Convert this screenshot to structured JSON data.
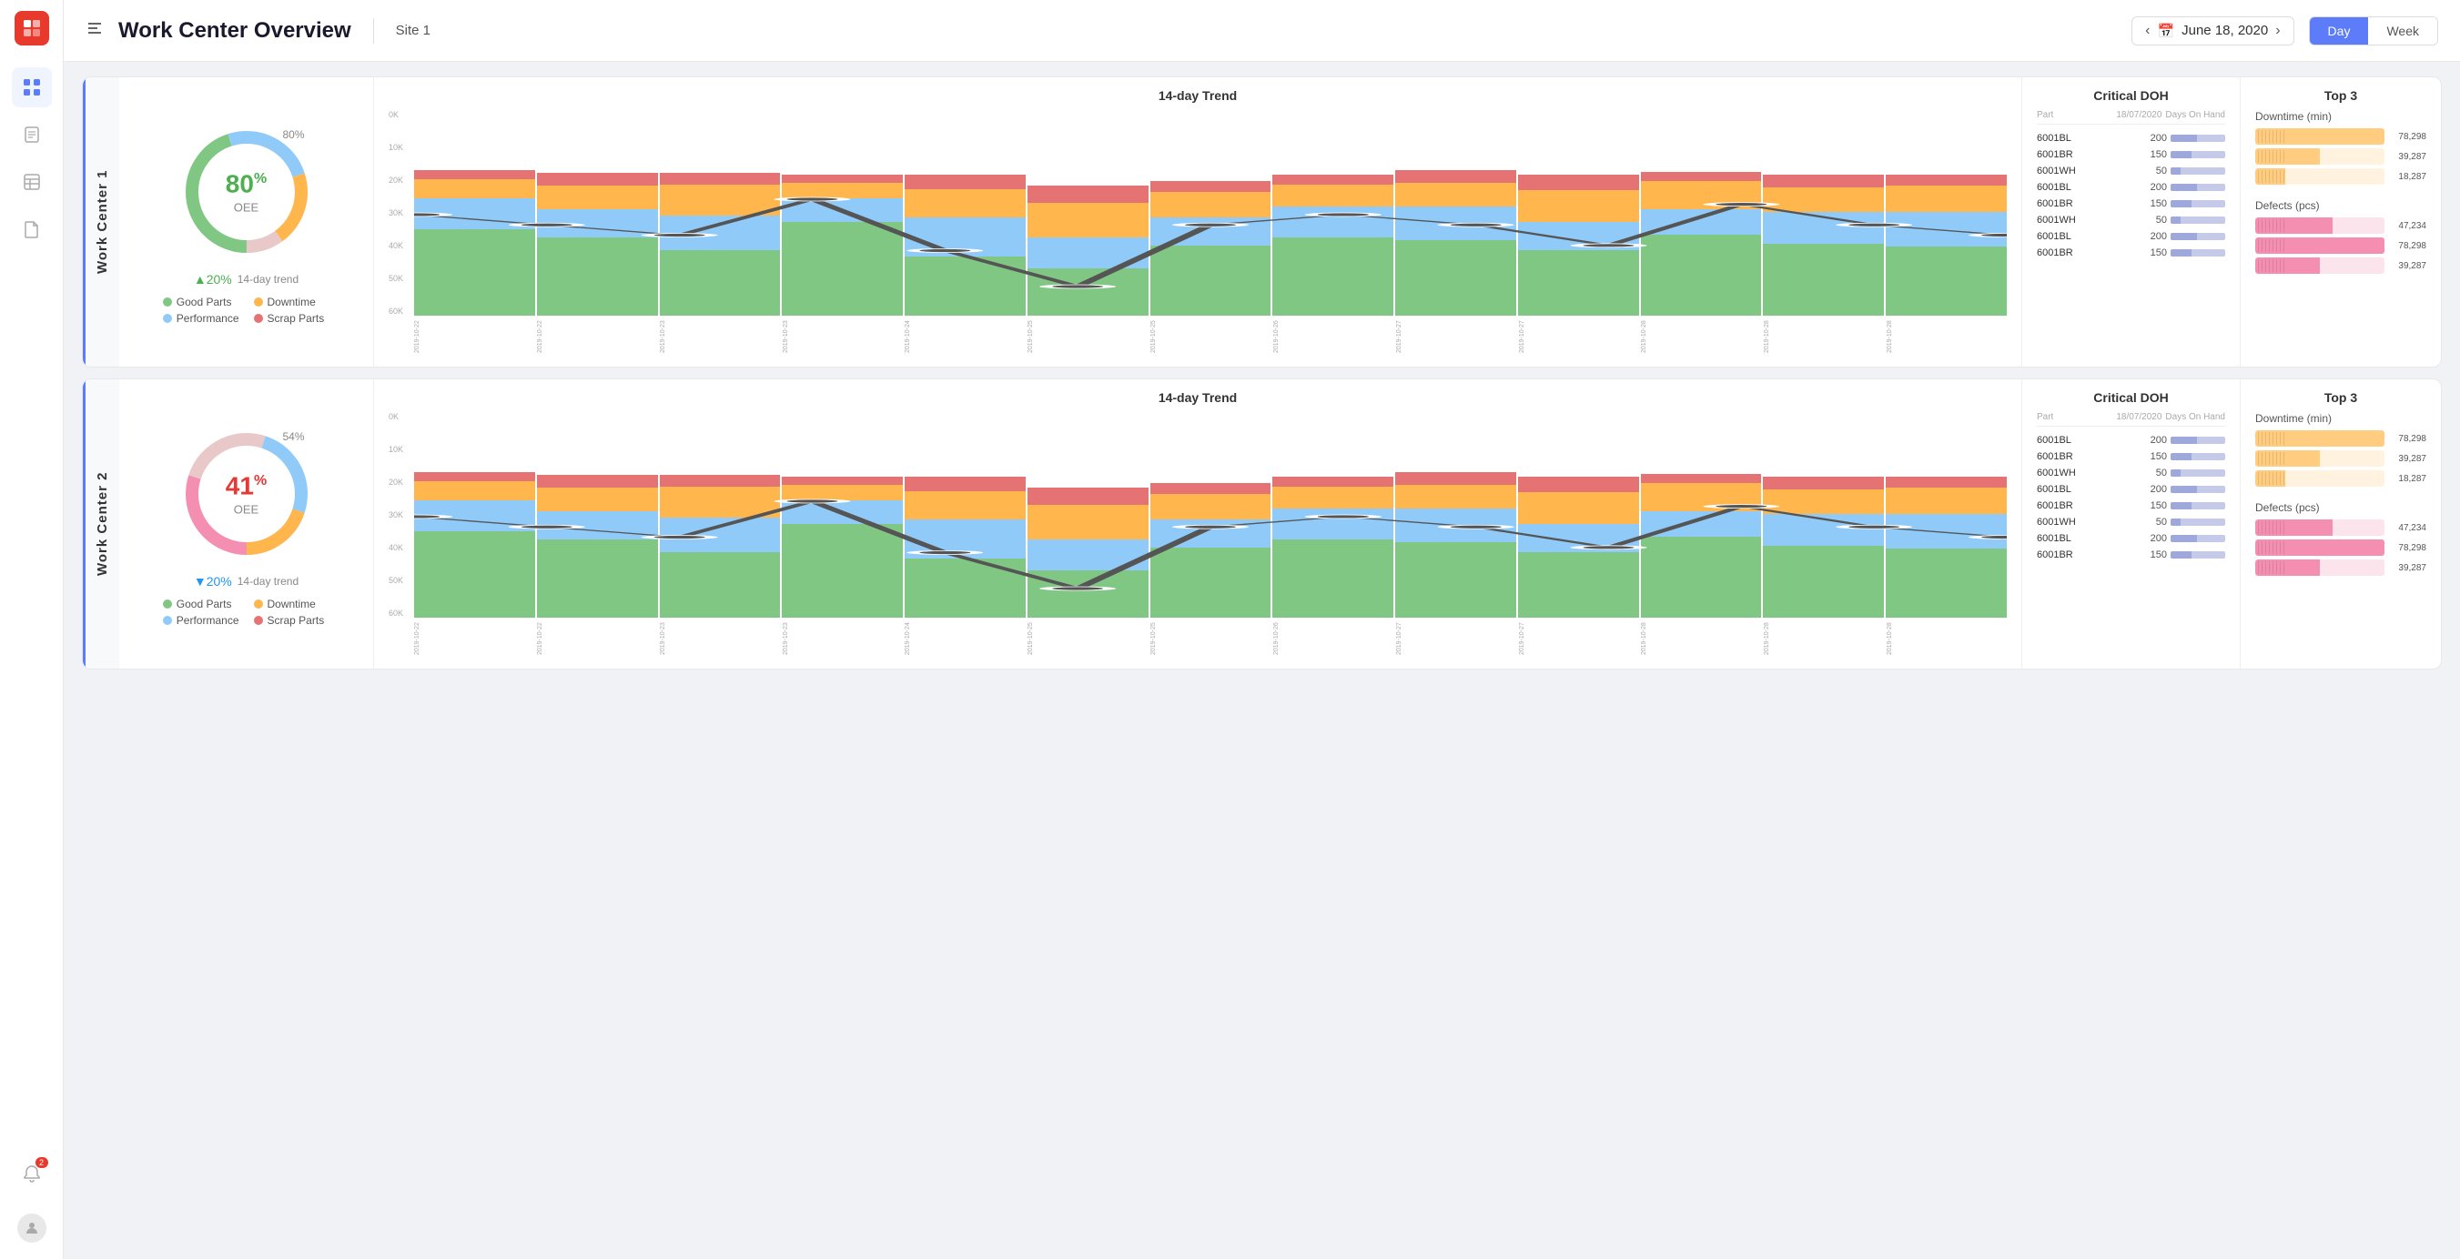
{
  "sidebar": {
    "logo": "P",
    "items": [
      {
        "id": "dashboard",
        "icon": "⊞",
        "active": true
      },
      {
        "id": "reports",
        "icon": "📄"
      },
      {
        "id": "table",
        "icon": "▦"
      },
      {
        "id": "document",
        "icon": "📋"
      },
      {
        "id": "notifications",
        "icon": "🔔",
        "badge": "2"
      }
    ]
  },
  "topbar": {
    "menu_icon": "≡",
    "title": "Work Center Overview",
    "site": "Site 1",
    "date": "June 18, 2020",
    "day_label": "Day",
    "week_label": "Week",
    "day_active": true
  },
  "work_centers": [
    {
      "id": "wc1",
      "label": "Work Center 1",
      "oee_pct": "80",
      "oee_pct_label": "80%",
      "oee_color": "green",
      "trend_pct": "+20%",
      "trend_dir": "up",
      "trend_text": "14-day trend",
      "donut_label_pos": "80%",
      "legend": [
        {
          "label": "Good Parts",
          "color": "#81c784"
        },
        {
          "label": "Downtime",
          "color": "#ffb74d"
        },
        {
          "label": "Performance",
          "color": "#90caf9"
        },
        {
          "label": "Scrap Parts",
          "color": "#e57373"
        }
      ],
      "chart_title": "14-day Trend",
      "y_labels": [
        "60K",
        "50K",
        "40K",
        "30K",
        "20K",
        "10K",
        "0K"
      ],
      "x_labels": [
        "2019-10-22",
        "2019-10-22",
        "2019-10-23",
        "2019-10-23",
        "2019-10-24",
        "2019-10-25",
        "2019-10-25",
        "2019-10-26",
        "2019-10-27",
        "2019-10-27",
        "2019-10-28",
        "2019-10-28",
        "2019-10-28"
      ],
      "bars": [
        {
          "green": 55,
          "blue": 20,
          "orange": 12,
          "red": 6
        },
        {
          "green": 50,
          "blue": 18,
          "orange": 15,
          "red": 8
        },
        {
          "green": 42,
          "blue": 22,
          "orange": 20,
          "red": 7
        },
        {
          "green": 60,
          "blue": 15,
          "orange": 10,
          "red": 5
        },
        {
          "green": 38,
          "blue": 25,
          "orange": 18,
          "red": 9
        },
        {
          "green": 30,
          "blue": 20,
          "orange": 22,
          "red": 11
        },
        {
          "green": 45,
          "blue": 18,
          "orange": 16,
          "red": 7
        },
        {
          "green": 50,
          "blue": 20,
          "orange": 14,
          "red": 6
        },
        {
          "green": 48,
          "blue": 22,
          "orange": 15,
          "red": 8
        },
        {
          "green": 42,
          "blue": 18,
          "orange": 20,
          "red": 10
        },
        {
          "green": 52,
          "blue": 16,
          "orange": 18,
          "red": 6
        },
        {
          "green": 46,
          "blue": 20,
          "orange": 16,
          "red": 8
        },
        {
          "green": 44,
          "blue": 22,
          "orange": 17,
          "red": 7
        }
      ],
      "trend_points": [
        52,
        50,
        48,
        55,
        45,
        38,
        50,
        52,
        50,
        46,
        54,
        50,
        48
      ],
      "critical_title": "Critical DOH",
      "critical_headers": [
        "Part",
        "18/07/2020",
        "Days On Hand"
      ],
      "critical_rows": [
        {
          "part": "6001BL",
          "date_val": "200",
          "fill1": 80,
          "fill2": 20
        },
        {
          "part": "6001BR",
          "date_val": "150",
          "fill1": 65,
          "fill2": 35
        },
        {
          "part": "6001WH",
          "date_val": "50",
          "fill1": 30,
          "fill2": 70
        },
        {
          "part": "6001BL",
          "date_val": "200",
          "fill1": 80,
          "fill2": 20
        },
        {
          "part": "6001BR",
          "date_val": "150",
          "fill1": 65,
          "fill2": 35
        },
        {
          "part": "6001WH",
          "date_val": "50",
          "fill1": 30,
          "fill2": 70
        },
        {
          "part": "6001BL",
          "date_val": "200",
          "fill1": 80,
          "fill2": 20
        },
        {
          "part": "6001BR",
          "date_val": "150",
          "fill1": 65,
          "fill2": 35
        }
      ],
      "top3_title": "Top 3",
      "downtime_label": "Downtime (min)",
      "downtime_bars": [
        {
          "val": "78,298",
          "pct": 100
        },
        {
          "val": "39,287",
          "pct": 50
        },
        {
          "val": "18,287",
          "pct": 23
        }
      ],
      "defects_label": "Defects (pcs)",
      "defects_bars": [
        {
          "val": "47,234",
          "pct": 60
        },
        {
          "val": "78,298",
          "pct": 100
        },
        {
          "val": "39,287",
          "pct": 50
        }
      ]
    },
    {
      "id": "wc2",
      "label": "Work Center 2",
      "oee_pct": "41",
      "oee_pct_label": "54%",
      "oee_color": "red",
      "trend_pct": "↓20%",
      "trend_dir": "down",
      "trend_text": "14-day trend",
      "donut_label_pos": "54%",
      "legend": [
        {
          "label": "Good Parts",
          "color": "#81c784"
        },
        {
          "label": "Downtime",
          "color": "#ffb74d"
        },
        {
          "label": "Performance",
          "color": "#90caf9"
        },
        {
          "label": "Scrap Parts",
          "color": "#e57373"
        }
      ],
      "chart_title": "14-day Trend",
      "y_labels": [
        "60K",
        "50K",
        "40K",
        "30K",
        "20K",
        "10K",
        "0K"
      ],
      "x_labels": [
        "2019-10-22",
        "2019-10-22",
        "2019-10-23",
        "2019-10-23",
        "2019-10-24",
        "2019-10-25",
        "2019-10-25",
        "2019-10-26",
        "2019-10-27",
        "2019-10-27",
        "2019-10-28",
        "2019-10-28",
        "2019-10-28"
      ],
      "bars": [
        {
          "green": 55,
          "blue": 20,
          "orange": 12,
          "red": 6
        },
        {
          "green": 50,
          "blue": 18,
          "orange": 15,
          "red": 8
        },
        {
          "green": 42,
          "blue": 22,
          "orange": 20,
          "red": 7
        },
        {
          "green": 60,
          "blue": 15,
          "orange": 10,
          "red": 5
        },
        {
          "green": 38,
          "blue": 25,
          "orange": 18,
          "red": 9
        },
        {
          "green": 30,
          "blue": 20,
          "orange": 22,
          "red": 11
        },
        {
          "green": 45,
          "blue": 18,
          "orange": 16,
          "red": 7
        },
        {
          "green": 50,
          "blue": 20,
          "orange": 14,
          "red": 6
        },
        {
          "green": 48,
          "blue": 22,
          "orange": 15,
          "red": 8
        },
        {
          "green": 42,
          "blue": 18,
          "orange": 20,
          "red": 10
        },
        {
          "green": 52,
          "blue": 16,
          "orange": 18,
          "red": 6
        },
        {
          "green": 46,
          "blue": 20,
          "orange": 16,
          "red": 8
        },
        {
          "green": 44,
          "blue": 22,
          "orange": 17,
          "red": 7
        }
      ],
      "trend_points": [
        52,
        50,
        48,
        55,
        45,
        38,
        50,
        52,
        50,
        46,
        54,
        50,
        48
      ],
      "critical_title": "Critical DOH",
      "critical_headers": [
        "Part",
        "18/07/2020",
        "Days On Hand"
      ],
      "critical_rows": [
        {
          "part": "6001BL",
          "date_val": "200",
          "fill1": 80,
          "fill2": 20
        },
        {
          "part": "6001BR",
          "date_val": "150",
          "fill1": 65,
          "fill2": 35
        },
        {
          "part": "6001WH",
          "date_val": "50",
          "fill1": 30,
          "fill2": 70
        },
        {
          "part": "6001BL",
          "date_val": "200",
          "fill1": 80,
          "fill2": 20
        },
        {
          "part": "6001BR",
          "date_val": "150",
          "fill1": 65,
          "fill2": 35
        },
        {
          "part": "6001WH",
          "date_val": "50",
          "fill1": 30,
          "fill2": 70
        },
        {
          "part": "6001BL",
          "date_val": "200",
          "fill1": 80,
          "fill2": 20
        },
        {
          "part": "6001BR",
          "date_val": "150",
          "fill1": 65,
          "fill2": 35
        }
      ],
      "top3_title": "Top 3",
      "downtime_label": "Downtime (min)",
      "downtime_bars": [
        {
          "val": "78,298",
          "pct": 100
        },
        {
          "val": "39,287",
          "pct": 50
        },
        {
          "val": "18,287",
          "pct": 23
        }
      ],
      "defects_label": "Defects (pcs)",
      "defects_bars": [
        {
          "val": "47,234",
          "pct": 60
        },
        {
          "val": "78,298",
          "pct": 100
        },
        {
          "val": "39,287",
          "pct": 50
        }
      ]
    }
  ],
  "colors": {
    "green": "#4caf50",
    "red": "#e53935",
    "blue_accent": "#5c7cfa",
    "bar_green": "#81c784",
    "bar_blue": "#90caf9",
    "bar_orange": "#ffb74d",
    "bar_red": "#e57373"
  }
}
